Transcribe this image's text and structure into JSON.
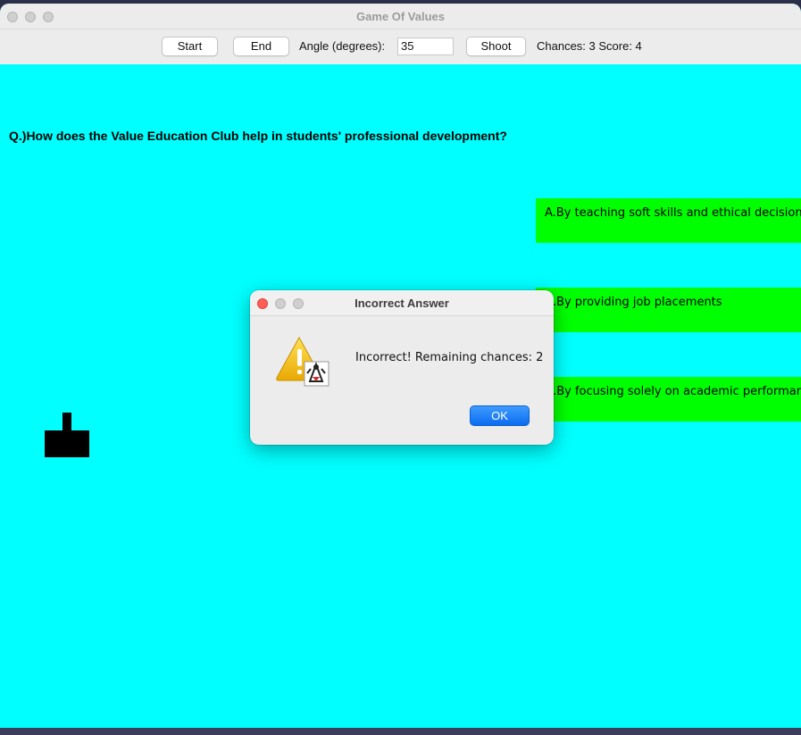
{
  "window": {
    "title": "Game Of Values"
  },
  "toolbar": {
    "start_label": "Start",
    "end_label": "End",
    "angle_label": "Angle (degrees):",
    "angle_value": "35",
    "shoot_label": "Shoot",
    "status": "Chances: 3 Score: 4"
  },
  "game": {
    "question": "Q.)How does the Value Education Club help in students' professional development?",
    "answers": [
      "A.By teaching soft skills and ethical decision-making",
      "B.By providing job placements",
      "C.By focusing solely on academic performance"
    ],
    "background_color": "#00ffff",
    "answer_color": "#00ff00"
  },
  "dialog": {
    "title": "Incorrect Answer",
    "message": "Incorrect! Remaining chances: 2",
    "ok_label": "OK",
    "icon": "warning-icon"
  },
  "colors": {
    "close_red": "#ff5f57",
    "ok_blue": "#1577f7"
  }
}
